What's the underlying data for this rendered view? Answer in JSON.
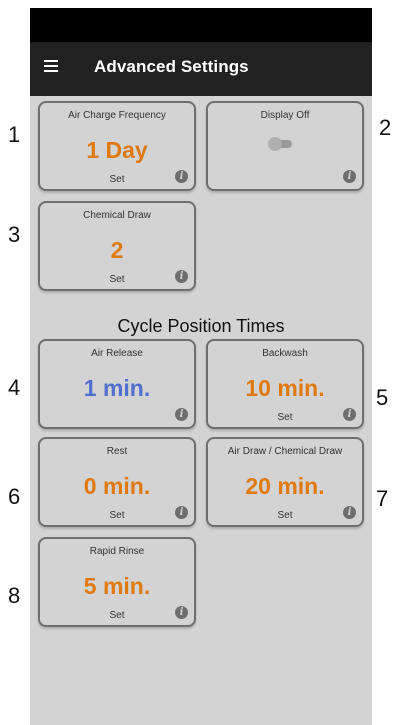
{
  "appbar": {
    "title": "Advanced Settings",
    "menu_icon": "hamburger-menu-icon"
  },
  "settings": [
    {
      "label": "Air Charge Frequency",
      "value": "1 Day",
      "set": "Set"
    },
    {
      "label": "Display Off",
      "toggle_on": false
    },
    {
      "label": "Chemical Draw",
      "value": "2",
      "set": "Set"
    }
  ],
  "section": {
    "title": "Cycle Position Times"
  },
  "cycles": [
    {
      "label": "Air Release",
      "value": "1 min."
    },
    {
      "label": "Backwash",
      "value": "10 min.",
      "set": "Set"
    },
    {
      "label": "Rest",
      "value": "0 min.",
      "set": "Set"
    },
    {
      "label": "Air Draw / Chemical Draw",
      "value": "20 min.",
      "set": "Set"
    },
    {
      "label": "Rapid Rinse",
      "value": "5 min.",
      "set": "Set"
    }
  ],
  "callouts": [
    "1",
    "2",
    "3",
    "4",
    "5",
    "6",
    "7",
    "8"
  ],
  "colors": {
    "value_orange": "#e07a10",
    "value_blue": "#4f6fd1",
    "appbar": "#212121",
    "background": "#d3d3d3"
  },
  "info_icon": "info-icon",
  "info_glyph": "i"
}
